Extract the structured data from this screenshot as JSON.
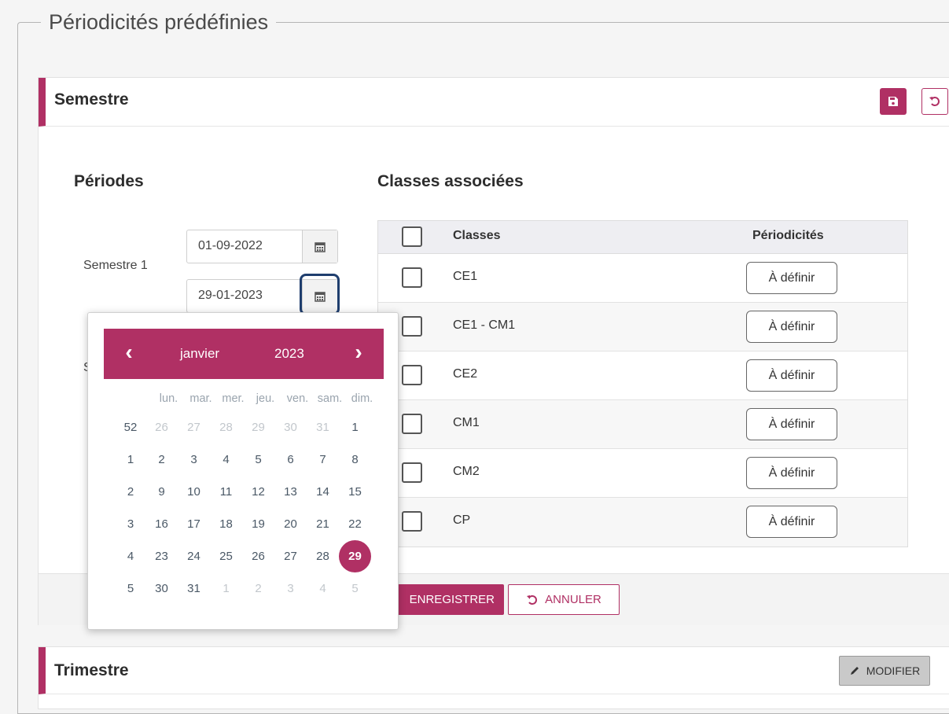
{
  "fieldset": {
    "legend": "Périodicités prédéfinies"
  },
  "semestre": {
    "title": "Semestre",
    "save_icon": "save-icon",
    "undo_icon": "undo-icon",
    "periods_title": "Périodes",
    "classes_title": "Classes associées",
    "semestre1_label": "Semestre 1",
    "semestre2_label": "S",
    "dates": {
      "start": "01-09-2022",
      "end": "29-01-2023"
    },
    "table": {
      "headers": {
        "classes": "Classes",
        "periodicites": "Périodicités"
      },
      "rows": [
        {
          "name": "CE1",
          "action": "À définir"
        },
        {
          "name": "CE1 - CM1",
          "action": "À définir"
        },
        {
          "name": "CE2",
          "action": "À définir"
        },
        {
          "name": "CM1",
          "action": "À définir"
        },
        {
          "name": "CM2",
          "action": "À définir"
        },
        {
          "name": "CP",
          "action": "À définir"
        }
      ]
    },
    "footer": {
      "save_label": "ENREGISTRER",
      "cancel_label": "ANNULER"
    }
  },
  "trimestre": {
    "title": "Trimestre",
    "modify_label": "MODIFIER"
  },
  "datepicker": {
    "month": "janvier",
    "year": "2023",
    "prev": "‹",
    "next": "›",
    "weekdays": [
      "lun.",
      "mar.",
      "mer.",
      "jeu.",
      "ven.",
      "sam.",
      "dim."
    ],
    "weeks": [
      {
        "num": "52",
        "days": [
          "26",
          "27",
          "28",
          "29",
          "30",
          "31",
          "1"
        ],
        "muted": [
          true,
          true,
          true,
          true,
          true,
          true,
          false
        ]
      },
      {
        "num": "1",
        "days": [
          "2",
          "3",
          "4",
          "5",
          "6",
          "7",
          "8"
        ],
        "muted": [
          false,
          false,
          false,
          false,
          false,
          false,
          false
        ]
      },
      {
        "num": "2",
        "days": [
          "9",
          "10",
          "11",
          "12",
          "13",
          "14",
          "15"
        ],
        "muted": [
          false,
          false,
          false,
          false,
          false,
          false,
          false
        ]
      },
      {
        "num": "3",
        "days": [
          "16",
          "17",
          "18",
          "19",
          "20",
          "21",
          "22"
        ],
        "muted": [
          false,
          false,
          false,
          false,
          false,
          false,
          false
        ]
      },
      {
        "num": "4",
        "days": [
          "23",
          "24",
          "25",
          "26",
          "27",
          "28",
          "29"
        ],
        "muted": [
          false,
          false,
          false,
          false,
          false,
          false,
          false
        ]
      },
      {
        "num": "5",
        "days": [
          "30",
          "31",
          "1",
          "2",
          "3",
          "4",
          "5"
        ],
        "muted": [
          false,
          false,
          true,
          true,
          true,
          true,
          true
        ]
      }
    ],
    "selected": "29"
  },
  "colors": {
    "accent": "#b03064",
    "focus_ring": "#1f3e6e"
  }
}
